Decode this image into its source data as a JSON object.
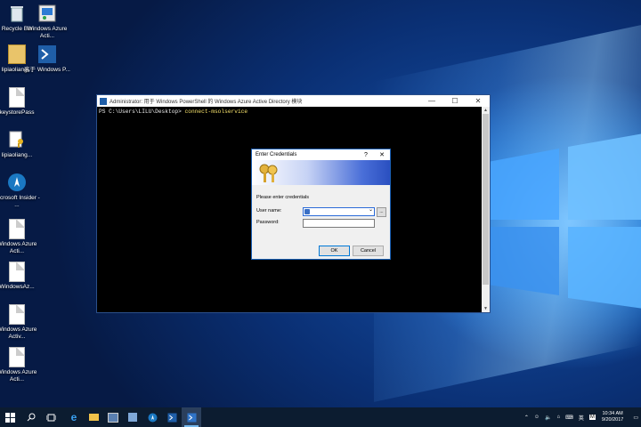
{
  "desktop": {
    "icons": [
      {
        "label": "Recycle Bin",
        "icon": "recycle-bin-icon"
      },
      {
        "label": "Windows Azure Acti...",
        "icon": "azure-app-icon"
      },
      {
        "label": "lipiaoliang...",
        "icon": "folder-icon"
      },
      {
        "label": "高于 Windows P...",
        "icon": "powershell-icon"
      },
      {
        "label": "keystorePass",
        "icon": "document-icon"
      },
      {
        "label": "lipiaoliang...",
        "icon": "keyfolder-icon"
      },
      {
        "label": "Microsoft Insider - ...",
        "icon": "insider-icon"
      },
      {
        "label": "Windows Azure Acti...",
        "icon": "document-icon"
      },
      {
        "label": "WindowsAz...",
        "icon": "document-icon"
      },
      {
        "label": "Windows Azure Activ...",
        "icon": "document-icon"
      },
      {
        "label": "Windows Azure Acti...",
        "icon": "document-icon"
      }
    ]
  },
  "console": {
    "title": "Administrator: 用于 Windows PowerShell 的 Windows Azure Active Directory 模块",
    "prompt": "PS C:\\Users\\LILU\\Desktop>",
    "command": "connect-msolservice",
    "minimize": "—",
    "maximize": "☐",
    "close": "✕"
  },
  "dialog": {
    "title": "Enter Credentials",
    "help": "?",
    "close": "✕",
    "prompt": "Please enter credentials",
    "username_label": "User name:",
    "password_label": "Password:",
    "ok": "OK",
    "cancel": "Cancel",
    "browse": "...",
    "dropdown": "⌄"
  },
  "taskbar": {
    "ime": "英",
    "lang_m": "M",
    "time": "10:34 AM",
    "date": "9/20/2017",
    "notifications_icon": "notification-icon"
  },
  "colors": {
    "accent": "#0078d7",
    "console_cmd": "#f7e26b"
  }
}
